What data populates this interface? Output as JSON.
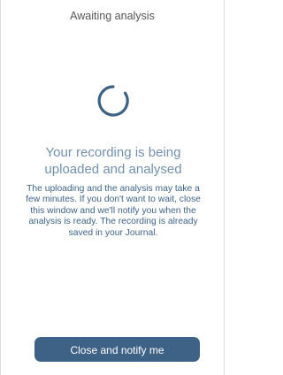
{
  "header": {
    "title": "Awaiting analysis"
  },
  "status": {
    "icon": "loading-spinner-icon",
    "heading": "Your recording is being uploaded and analysed",
    "message": "The uploading and the analysis may take a few minutes. If you don't want to wait, close this window and we'll notify you when the analysis is ready. The recording is already saved in your Journal."
  },
  "actions": {
    "close_label": "Close and notify me"
  },
  "colors": {
    "accent": "#3e6286",
    "heading": "#7390ad",
    "body_text": "#3e6287",
    "title": "#555555"
  }
}
